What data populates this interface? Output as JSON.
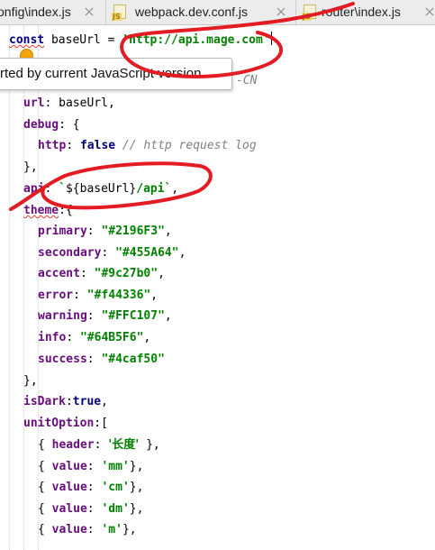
{
  "tabs": [
    {
      "label": "onfig\\index.js"
    },
    {
      "label": "webpack.dev.conf.js",
      "icon_text": "JS"
    },
    {
      "label": "router\\index.js",
      "icon_text": "JS"
    }
  ],
  "tooltip": {
    "text": "rted by current JavaScript version"
  },
  "code": {
    "l1": {
      "kw": "const",
      "name": "baseUrl",
      "op": " = ",
      "value": "'http://api.mage.com'"
    },
    "l2": {
      "tail": "-CN"
    },
    "l3": {
      "key": "url",
      "sep": ": ",
      "value": "baseUrl",
      "end": ","
    },
    "l4": {
      "key": "debug",
      "sep": ": ",
      "open": "{"
    },
    "l5": {
      "key": "http",
      "sep": ": ",
      "value": "false",
      "comment": " // http request log"
    },
    "l6": {
      "close": "},"
    },
    "l7": {
      "key": "api",
      "sep": ": ",
      "tpl_open": "`",
      "tpl_expr": "${baseUrl}",
      "tpl_rest": "/api`",
      "end": ","
    },
    "l8": {
      "key": "theme",
      "sep": ":",
      "open": "{"
    },
    "theme": [
      {
        "key": "primary",
        "value": "\"#2196F3\""
      },
      {
        "key": "secondary",
        "value": "\"#455A64\""
      },
      {
        "key": "accent",
        "value": "\"#9c27b0\""
      },
      {
        "key": "error",
        "value": "\"#f44336\""
      },
      {
        "key": "warning",
        "value": "\"#FFC107\""
      },
      {
        "key": "info",
        "value": "\"#64B5F6\""
      },
      {
        "key": "success",
        "value": "\"#4caf50\""
      }
    ],
    "l16": {
      "close": "},"
    },
    "l17": {
      "key": "isDark",
      "sep": ":",
      "value": "true",
      "end": ","
    },
    "l18": {
      "key": "unitOption",
      "sep": ":",
      "open": "["
    },
    "unit_items": [
      {
        "open": "{ ",
        "key": "header",
        "sep": ": ",
        "value": "'长度'",
        "close": " },"
      },
      {
        "open": "{ ",
        "key": "value",
        "sep": ": ",
        "value": "'mm'",
        "close": "},"
      },
      {
        "open": "{ ",
        "key": "value",
        "sep": ": ",
        "value": "'cm'",
        "close": "},"
      },
      {
        "open": "{ ",
        "key": "value",
        "sep": ": ",
        "value": "'dm'",
        "close": "},"
      },
      {
        "open": "{ ",
        "key": "value",
        "sep": ": ",
        "value": "'m'",
        "close": "},"
      }
    ]
  },
  "colors": {
    "keyword": "#000080",
    "property": "#660e7a",
    "string": "#008000",
    "comment": "#808080",
    "annotation": "#e31b23",
    "squiggle": "#e53935"
  },
  "icons": [
    "js-file-icon",
    "close-icon",
    "lightbulb-icon"
  ]
}
